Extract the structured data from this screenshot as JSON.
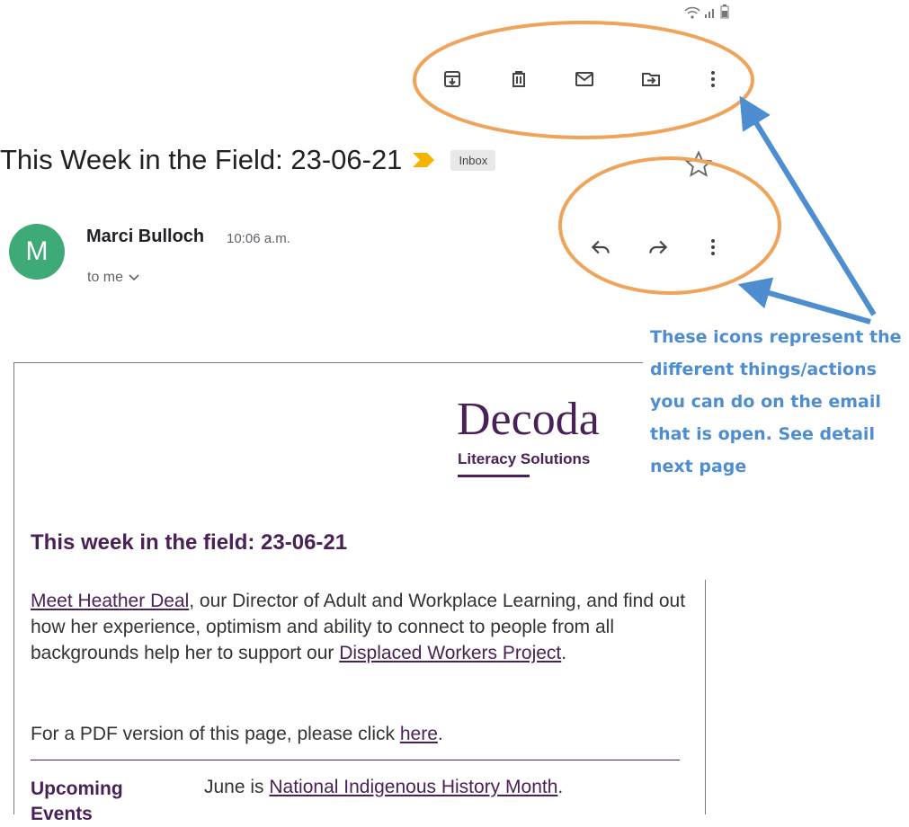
{
  "toolbar": {
    "icons": [
      "archive-icon",
      "delete-icon",
      "mark-unread-icon",
      "move-to-icon",
      "more-vert-icon"
    ]
  },
  "email": {
    "subject": "This Week in the Field: 23-06-21",
    "label_badge": "Inbox",
    "sender": {
      "initial": "M",
      "name": "Marci Bulloch",
      "time": "10:06 a.m.",
      "recipient": "to me"
    },
    "actions": [
      "reply-icon",
      "forward-icon",
      "more-vert-icon"
    ],
    "body": {
      "logo_text": "Decoda",
      "logo_subtext": "Literacy Solutions",
      "heading": "This week in the field: 23-06-21",
      "para1": {
        "link1": "Meet Heather Deal",
        "text1": ", our Director of Adult and Workplace Learning, and find out how her experience, optimism and ability to connect to people from all backgrounds help her to support our ",
        "link2": "Displaced Workers Project",
        "text2": "."
      },
      "para2": {
        "text1": "For a PDF version of this page, please click ",
        "link": "here",
        "text2": "."
      },
      "upcoming_label": "Upcoming Events",
      "event": {
        "text1": "June is ",
        "link": "National Indigenous History Month",
        "text2": "."
      }
    }
  },
  "annotation": {
    "text": "These icons represent the different things/actions you can do on the email that is open. See detail next page",
    "ellipse_color": "#f0a35a",
    "arrow_color": "#4e8ed0"
  },
  "colors": {
    "brand": "#4a2156",
    "avatar": "#3daa77",
    "importance_marker": "#f4b400"
  }
}
